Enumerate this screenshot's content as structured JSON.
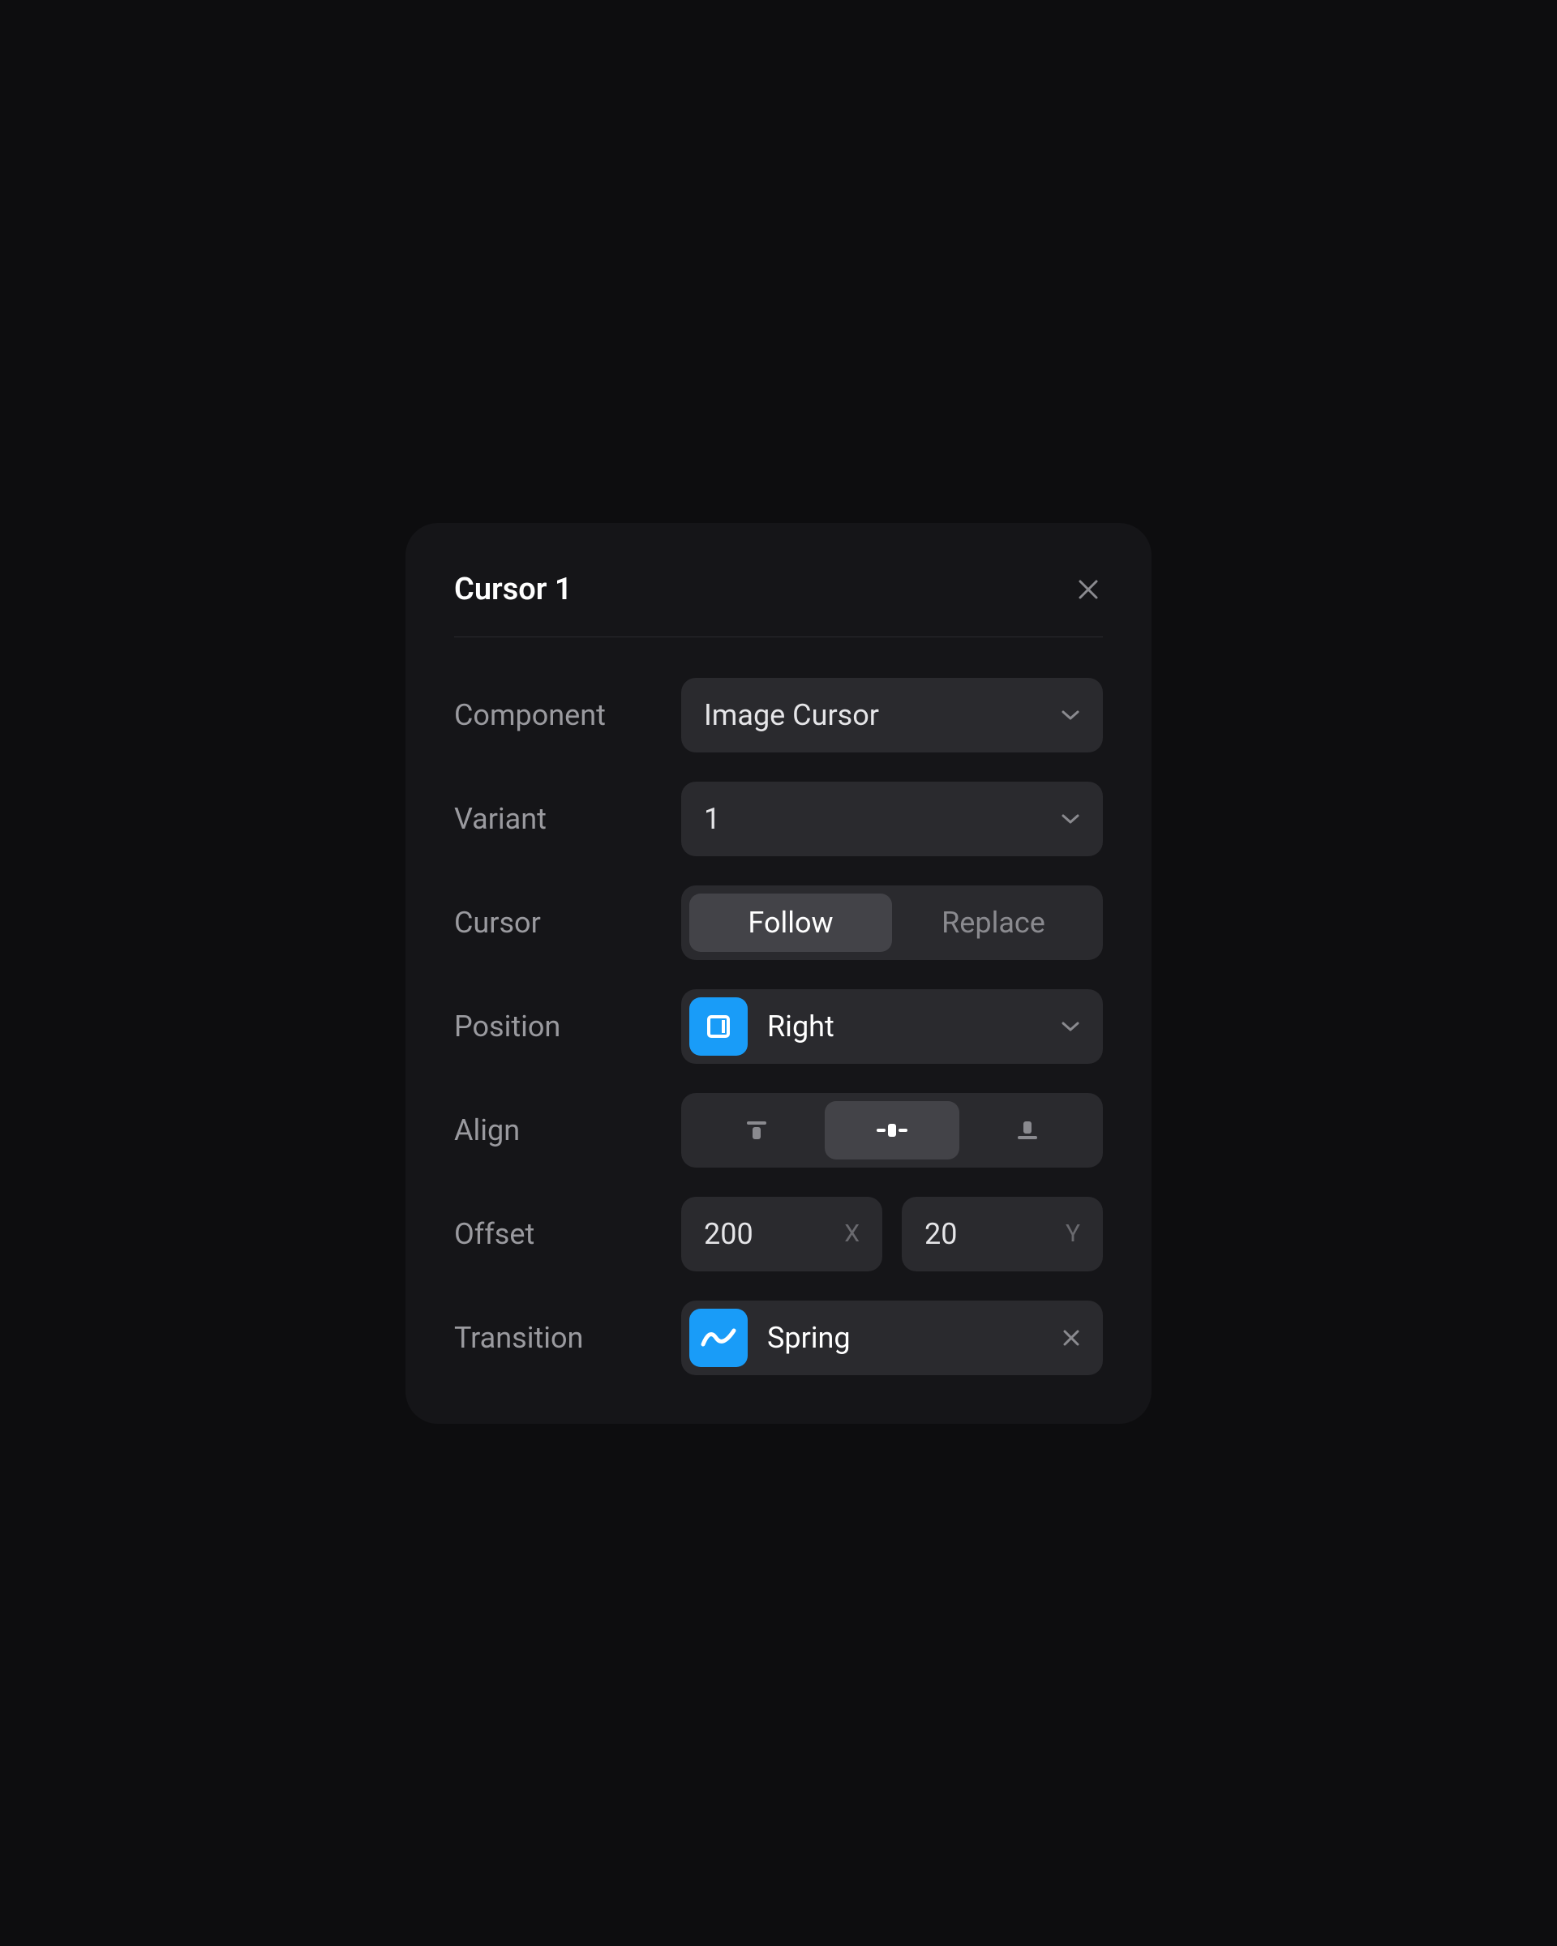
{
  "panel": {
    "title": "Cursor 1"
  },
  "labels": {
    "component": "Component",
    "variant": "Variant",
    "cursor": "Cursor",
    "position": "Position",
    "align": "Align",
    "offset": "Offset",
    "transition": "Transition"
  },
  "values": {
    "component": "Image Cursor",
    "variant": "1",
    "cursor_follow": "Follow",
    "cursor_replace": "Replace",
    "position": "Right",
    "offset_x": "200",
    "offset_x_suffix": "X",
    "offset_y": "20",
    "offset_y_suffix": "Y",
    "transition": "Spring"
  }
}
